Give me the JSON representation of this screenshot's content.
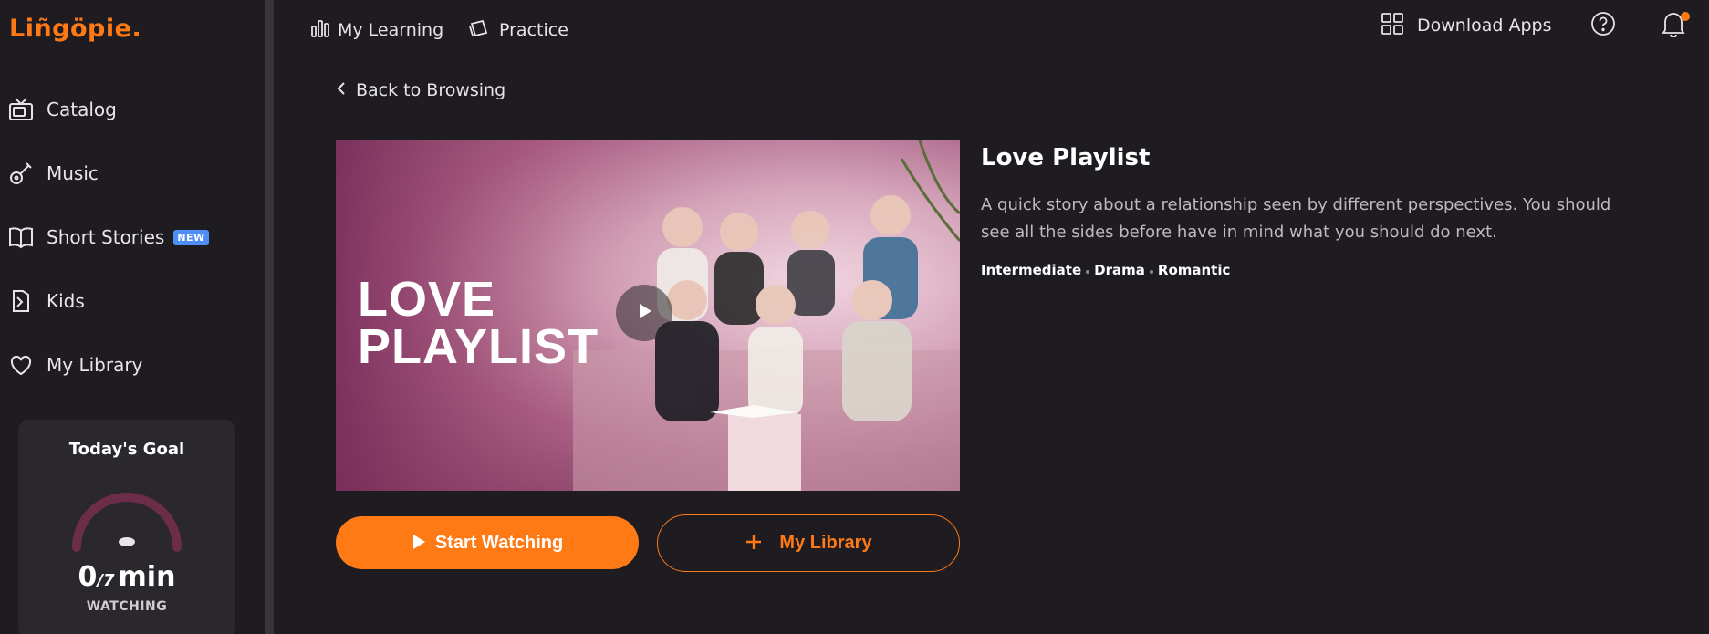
{
  "app": {
    "logo": "Liñgöpie.",
    "accent_color": "#ff7a15"
  },
  "sidebar": {
    "items": [
      {
        "label": "Catalog",
        "icon": "tv-icon"
      },
      {
        "label": "Music",
        "icon": "guitar-icon"
      },
      {
        "label": "Short Stories",
        "icon": "book-icon",
        "badge": "NEW"
      },
      {
        "label": "Kids",
        "icon": "kids-icon"
      },
      {
        "label": "My Library",
        "icon": "heart-icon"
      }
    ]
  },
  "goal": {
    "title": "Today's Goal",
    "value": "0",
    "target": "/7",
    "unit": "min",
    "label": "WATCHING",
    "progress": 0
  },
  "topnav": {
    "my_learning": "My Learning",
    "practice": "Practice",
    "download_apps": "Download Apps"
  },
  "main": {
    "back_label": "Back to Browsing",
    "poster_title_line1": "LOVE",
    "poster_title_line2": "PLAYLIST",
    "title": "Love Playlist",
    "description": "A quick story about a relationship seen by different perspectives. You should see all the sides before have in mind what you should do next.",
    "tags": [
      "Intermediate",
      "Drama",
      "Romantic"
    ],
    "start_button": "Start Watching",
    "library_button": "My Library"
  }
}
